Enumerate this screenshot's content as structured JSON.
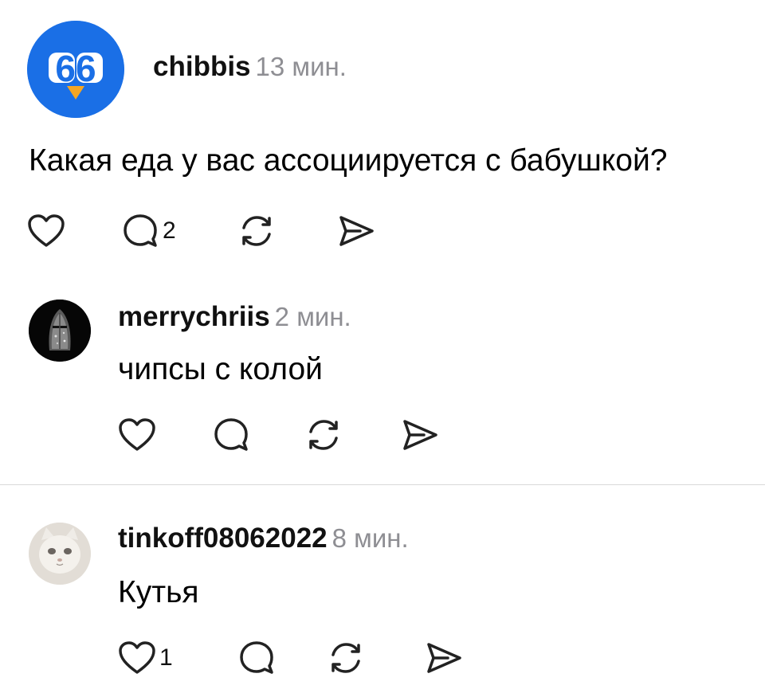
{
  "post": {
    "author": "chibbis",
    "time": "13 мин.",
    "avatar_icon": "chibbis-logo-icon",
    "avatar_text": "66",
    "avatar_color": "#1a6fe6",
    "text": "Какая еда у вас ассоциируется с бабушкой?",
    "likes": "",
    "comments": "2"
  },
  "replies": [
    {
      "author": "merrychriis",
      "time": "2 мин.",
      "avatar_icon": "knight-helmet-icon",
      "text": "чипсы с колой",
      "likes": "",
      "comments": ""
    },
    {
      "author": "tinkoff08062022",
      "time": "8 мин.",
      "avatar_icon": "cat-face-icon",
      "text": "Кутья",
      "likes": "1",
      "comments": ""
    }
  ],
  "icons": [
    "heart-icon",
    "comment-icon",
    "repost-icon",
    "share-icon"
  ]
}
